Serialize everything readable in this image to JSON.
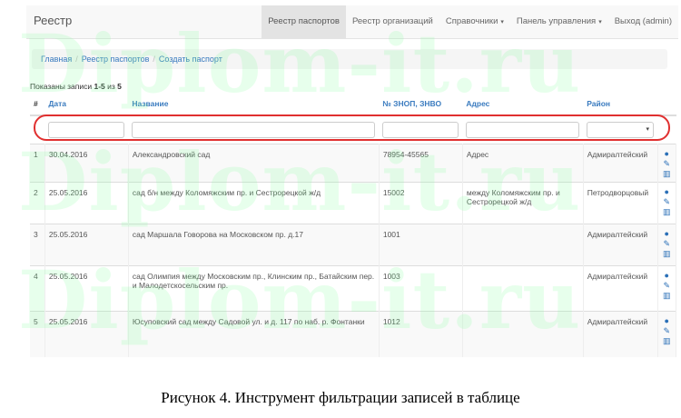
{
  "navbar": {
    "brand": "Реестр",
    "items": [
      {
        "label": "Реестр паспортов",
        "dropdown": false,
        "active": true
      },
      {
        "label": "Реестр организаций",
        "dropdown": false,
        "active": false
      },
      {
        "label": "Справочники",
        "dropdown": true,
        "active": false
      },
      {
        "label": "Панель управления",
        "dropdown": true,
        "active": false
      },
      {
        "label": "Выход (admin)",
        "dropdown": false,
        "active": false
      }
    ]
  },
  "breadcrumb": [
    "Главная",
    "Реестр паспортов",
    "Создать паспорт"
  ],
  "summary": {
    "prefix": "Показаны записи ",
    "range": "1-5",
    "middle": " из ",
    "total": "5"
  },
  "table": {
    "columns": [
      "#",
      "Дата",
      "Название",
      "№ ЗНОП, ЗНВО",
      "Адрес",
      "Район"
    ],
    "rows": [
      {
        "n": "1",
        "date": "30.04.2016",
        "name": "Александровский сад",
        "znop": "78954-45565",
        "address": "Адрес",
        "district": "Адмиралтейский"
      },
      {
        "n": "2",
        "date": "25.05.2016",
        "name": "сад б/н между Коломяжским пр. и Сестрорецкой ж/д",
        "znop": "15002",
        "address": "между Коломяжским пр. и Сестрорецкой ж/д",
        "district": "Петродворцовый"
      },
      {
        "n": "3",
        "date": "25.05.2016",
        "name": "сад Маршала Говорова на Московском пр. д.17",
        "znop": "1001",
        "address": "",
        "district": "Адмиралтейский"
      },
      {
        "n": "4",
        "date": "25.05.2016",
        "name": "сад Олимпия между Московским пр., Клинским пр., Батайским пер. и Малодетскосельским пр.",
        "znop": "1003",
        "address": "",
        "district": "Адмиралтейский"
      },
      {
        "n": "5",
        "date": "25.05.2016",
        "name": "Юсуповский сад между Садовой ул. и д. 117 по наб. р. Фонтанки",
        "znop": "1012",
        "address": "",
        "district": "Адмиралтейский"
      }
    ]
  },
  "icons": [
    "eye-icon",
    "pencil-icon",
    "trash-icon"
  ],
  "accent_color": "#3a7bbf",
  "highlight_color": "#e03030",
  "watermark": "Diplom-it.ru",
  "caption": "Рисунок 4. Инструмент фильтрации записей в таблице"
}
